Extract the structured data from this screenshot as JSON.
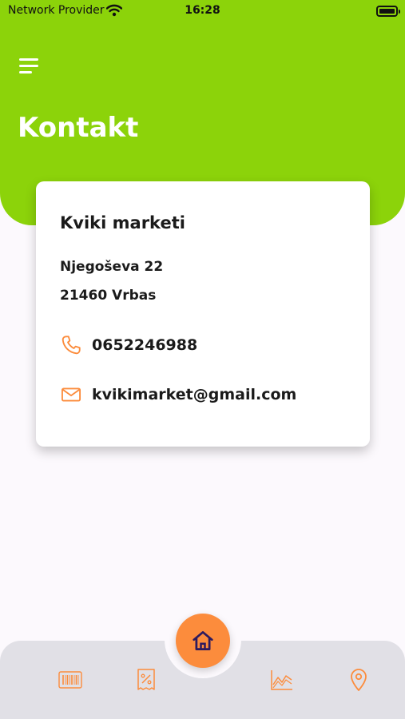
{
  "status_bar": {
    "carrier": "Network Provider",
    "time": "16:28"
  },
  "header": {
    "title": "Kontakt"
  },
  "contact_card": {
    "name": "Kviki marketi",
    "address_line1": "Njegoševa 22",
    "address_line2": "21460 Vrbas",
    "phone": "0652246988",
    "email": "kvikimarket@gmail.com"
  },
  "colors": {
    "header_green": "#8cd30a",
    "accent_orange": "#fc8c3c",
    "nav_background": "#e1e0e6",
    "home_icon": "#2d1a5e"
  },
  "bottom_nav": {
    "items": [
      {
        "icon": "barcode-icon"
      },
      {
        "icon": "discount-receipt-icon"
      },
      {
        "icon": "home-icon",
        "active": true
      },
      {
        "icon": "chart-icon"
      },
      {
        "icon": "location-pin-icon"
      }
    ]
  }
}
